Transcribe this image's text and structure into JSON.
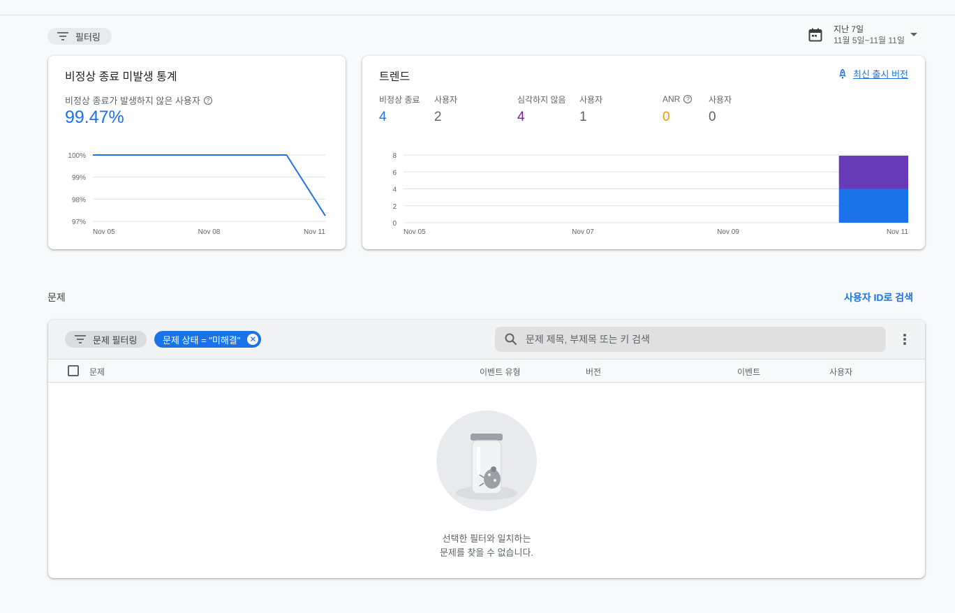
{
  "toolbar": {
    "filter_label": "필터링",
    "date_range_title": "지난 7일",
    "date_range_value": "11월 5일~11월 11일"
  },
  "crash_free_card": {
    "title": "비정상 종료 미발생 통계",
    "metric_label": "비정상 종료가 발생하지 않은 사용자",
    "metric_value": "99.47%"
  },
  "trend_card": {
    "title": "트렌드",
    "latest_release_link": "최신 출시 버전",
    "metrics": [
      {
        "label": "비정상 종료",
        "value": "4",
        "color": "#1a73e8"
      },
      {
        "label": "사용자",
        "value": "2",
        "color": "#5f6368"
      },
      {
        "label": "심각하지 않음",
        "value": "4",
        "color": "#7b1fa2"
      },
      {
        "label": "사용자",
        "value": "1",
        "color": "#5f6368"
      },
      {
        "label": "ANR",
        "value": "0",
        "color": "#f29900"
      },
      {
        "label": "사용자",
        "value": "0",
        "color": "#5f6368"
      }
    ]
  },
  "issues": {
    "section_title": "문제",
    "search_by_user": "사용자 ID로 검색",
    "filter_chip": "문제 필터링",
    "status_chip": "문제 상태 = \"미해결\"",
    "search_placeholder": "문제 제목, 부제목 또는 키 검색",
    "columns": [
      "문제",
      "이벤트 유형",
      "버전",
      "이벤트",
      "사용자"
    ],
    "empty_line1": "선택한 필터와 일치하는",
    "empty_line2": "문제를 찾을 수 없습니다."
  },
  "chart_data": [
    {
      "type": "line",
      "title": "",
      "x": [
        "Nov 05",
        "Nov 06",
        "Nov 07",
        "Nov 08",
        "Nov 09",
        "Nov 10",
        "Nov 11"
      ],
      "x_ticks": [
        "Nov 05",
        "Nov 08",
        "Nov 11"
      ],
      "series": [
        {
          "values": [
            100,
            100,
            100,
            100,
            100,
            100,
            97.25
          ],
          "color": "#1a73e8"
        }
      ],
      "y_ticks": [
        "100%",
        "99%",
        "98%",
        "97%"
      ],
      "ylim": [
        97,
        100
      ],
      "grid": true
    },
    {
      "type": "bar",
      "stacked": true,
      "categories": [
        "Nov 05",
        "Nov 06",
        "Nov 07",
        "Nov 08",
        "Nov 09",
        "Nov 10",
        "Nov 11"
      ],
      "x_ticks": [
        "Nov 05",
        "Nov 07",
        "Nov 09",
        "Nov 11"
      ],
      "series": [
        {
          "values": [
            0,
            0,
            0,
            0,
            0,
            0,
            4
          ],
          "color": "#1a73e8"
        },
        {
          "values": [
            0,
            0,
            0,
            0,
            0,
            0,
            4
          ],
          "color": "#673ab7"
        }
      ],
      "y_ticks": [
        0,
        2,
        4,
        6,
        8
      ],
      "ylim": [
        0,
        8
      ],
      "grid": true
    }
  ]
}
